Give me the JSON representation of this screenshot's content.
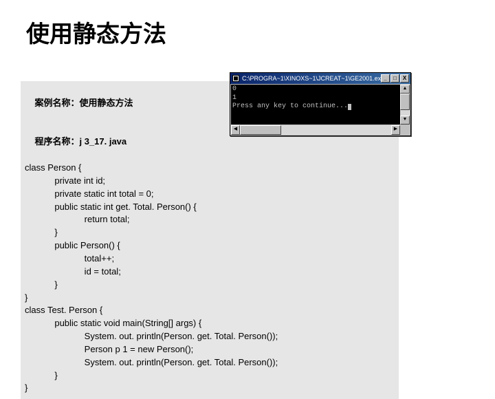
{
  "title": "使用静态方法",
  "code_header": {
    "line1_label": "案例名称：",
    "line1_value": "使用静态方法",
    "line2_label": "程序名称：",
    "line2_value": "j 3_17. java"
  },
  "code_lines": [
    "class Person {",
    "            private int id;",
    "            private static int total = 0;",
    "            public static int get. Total. Person() {",
    "                        return total;",
    "            }",
    "            public Person() {",
    "                        total++;",
    "                        id = total;",
    "            }",
    "}",
    "class Test. Person {",
    "            public static void main(String[] args) {",
    "                        System. out. println(Person. get. Total. Person());",
    "                        Person p 1 = new Person();",
    "                        System. out. println(Person. get. Total. Person());",
    "            }",
    "}"
  ],
  "console": {
    "title": "C:\\PROGRA~1\\XINOXS~1\\JCREAT~1\\GE2001.exe",
    "output_lines": [
      "0",
      "1",
      "Press any key to continue..."
    ],
    "btn_min": "_",
    "btn_max": "□",
    "btn_close": "X",
    "arrow_up": "▲",
    "arrow_down": "▼",
    "arrow_left": "◀",
    "arrow_right": "▶"
  }
}
